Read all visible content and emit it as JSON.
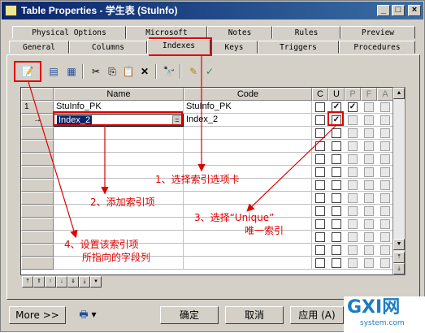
{
  "window": {
    "title": "Table Properties - 学生表 (StuInfo)",
    "controls": [
      "_",
      "□",
      "×"
    ]
  },
  "tabs": {
    "row1": [
      "Physical Options",
      "Microsoft",
      "Notes",
      "Rules",
      "Preview"
    ],
    "row2": [
      "General",
      "Columns",
      "Indexes",
      "Keys",
      "Triggers",
      "Procedures"
    ],
    "active": "Indexes"
  },
  "grid": {
    "headers": [
      "Name",
      "Code",
      "C",
      "U",
      "P",
      "F",
      "A"
    ],
    "rows": [
      {
        "num": "1",
        "name": "StuInfo_PK",
        "code": "StuInfo_PK",
        "checks": [
          false,
          true,
          true,
          false,
          false
        ]
      },
      {
        "num": "→",
        "name": "Index_2",
        "code": "Index_2",
        "eq": "=",
        "checks": [
          false,
          true,
          false,
          false,
          false
        ]
      }
    ]
  },
  "annotations": {
    "a1": "1、选择索引选项卡",
    "a2": "2、添加索引项",
    "a3_line1": "3、选择“Unique”",
    "a3_line2": "唯一索引",
    "a4_line1": "4、设置该索引项",
    "a4_line2": "所指向的字段列"
  },
  "buttons": {
    "more": "More >>",
    "ok": "确定",
    "cancel": "取消",
    "apply": "应用 (A)"
  },
  "watermark": {
    "brand": "GXI网",
    "domain": "system.com"
  },
  "colors": {
    "accent": "#e00000",
    "titlebar": "#0a246a"
  }
}
